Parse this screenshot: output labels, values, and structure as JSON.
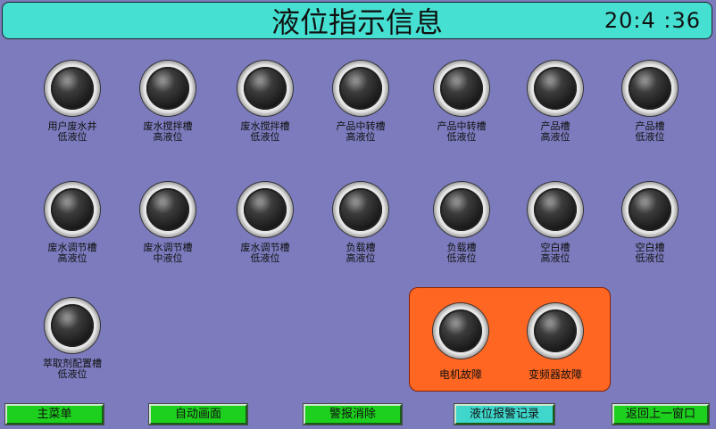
{
  "header": {
    "title": "液位指示信息",
    "clock": "20:4 :36"
  },
  "lamps": [
    {
      "label": "用户废水井\n低液位"
    },
    {
      "label": "废水搅拌槽\n高液位"
    },
    {
      "label": "废水搅拌槽\n低液位"
    },
    {
      "label": "产品中转槽\n高液位"
    },
    {
      "label": "产品中转槽\n低液位"
    },
    {
      "label": "产品槽\n高液位"
    },
    {
      "label": "产品槽\n低液位"
    },
    {
      "label": "废水调节槽\n高液位"
    },
    {
      "label": "废水调节槽\n中液位"
    },
    {
      "label": "废水调节槽\n低液位"
    },
    {
      "label": "负载槽\n高液位"
    },
    {
      "label": "负载槽\n低液位"
    },
    {
      "label": "空白槽\n高液位"
    },
    {
      "label": "空白槽\n低液位"
    },
    {
      "label": "萃取剂配置槽\n低液位"
    }
  ],
  "faults": [
    {
      "label": "电机故障"
    },
    {
      "label": "变频器故障"
    }
  ],
  "buttons": {
    "main_menu": "主菜单",
    "auto_screen": "自动画面",
    "alarm_clear": "警报消除",
    "level_alarm_log": "液位报警记录",
    "back": "返回上一窗口"
  },
  "colors": {
    "background": "#7b7bbd",
    "header": "#45e0d2",
    "fault_panel": "#ff6622",
    "button_green": "#1dd01d",
    "button_teal": "#3fd6cc"
  }
}
